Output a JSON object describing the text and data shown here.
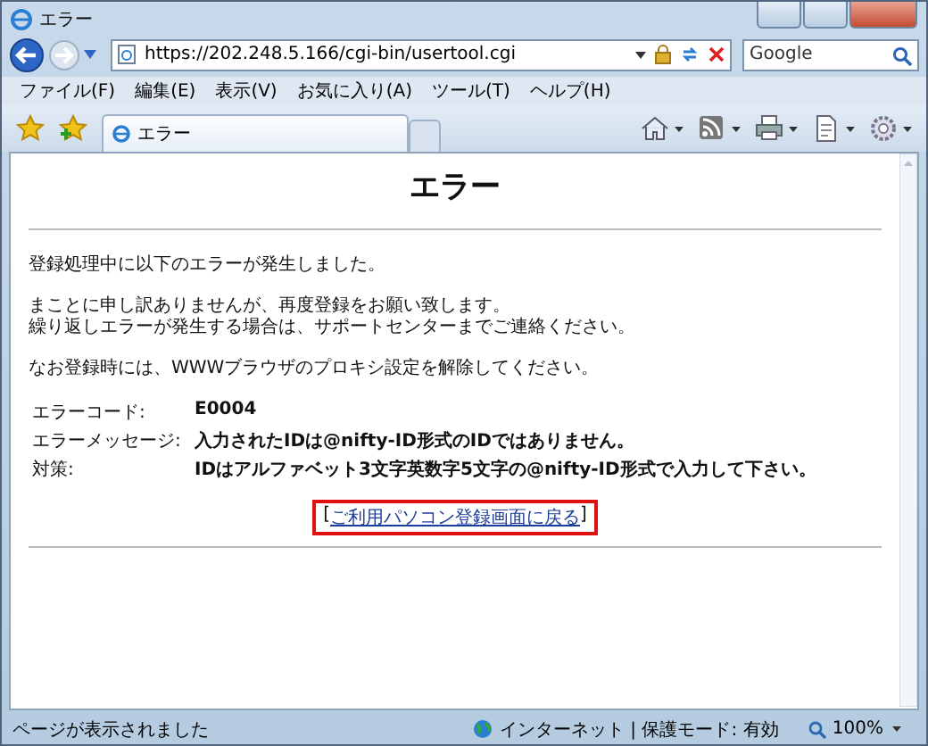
{
  "window": {
    "title": "エラー"
  },
  "address_bar": {
    "value": "https://202.248.5.166/cgi-bin/usertool.cgi"
  },
  "search": {
    "placeholder": "Google"
  },
  "menu": [
    "ファイル(F)",
    "編集(E)",
    "表示(V)",
    "お気に入り(A)",
    "ツール(T)",
    "ヘルプ(H)"
  ],
  "tabs": [
    {
      "label": "エラー",
      "selected": true
    }
  ],
  "page": {
    "heading": "エラー",
    "paragraphs": [
      [
        "登録処理中に以下のエラーが発生しました。"
      ],
      [
        "まことに申し訳ありませんが、再度登録をお願い致します。",
        "繰り返しエラーが発生する場合は、サポートセンターまでご連絡ください。"
      ],
      [
        "なお登録時には、WWWブラウザのプロキシ設定を解除してください。"
      ]
    ],
    "details": [
      {
        "label": "エラーコード:",
        "value": "E0004"
      },
      {
        "label": "エラーメッセージ:",
        "value": "入力されたIDは@nifty-ID形式のIDではありません。"
      },
      {
        "label": "対策:",
        "value": "IDはアルファベット3文字英数字5文字の@nifty-ID形式で入力して下さい。"
      }
    ],
    "link": {
      "open": "[",
      "text": "ご利用パソコン登録画面に戻る",
      "close": "]"
    }
  },
  "status_bar": {
    "message": "ページが表示されました",
    "zone": "インターネット | 保護モード: 有効",
    "zoom": "100%"
  }
}
